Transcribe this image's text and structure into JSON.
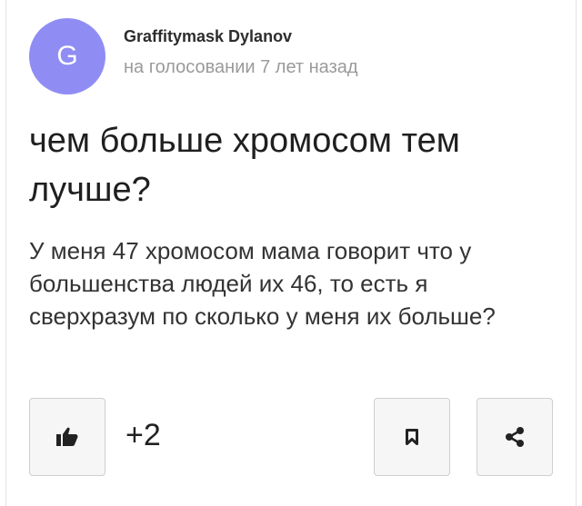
{
  "post": {
    "avatar_letter": "G",
    "author": "Graffitymask Dylanov",
    "meta": "на голосовании 7 лет назад",
    "title": "чем больше хромосом тем лучше?",
    "body": "У меня 47 хромосом мама говорит что у большенства людей их 46, то есть я сверхразум по сколько у меня их больше?",
    "like_count": "+2"
  },
  "icons": {
    "like": "thumbs-up-icon",
    "bookmark": "bookmark-icon",
    "share": "share-icon"
  },
  "colors": {
    "avatar_bg": "#8f8df4",
    "meta_text": "#9a9a9a",
    "button_border": "#cfcfcf"
  }
}
